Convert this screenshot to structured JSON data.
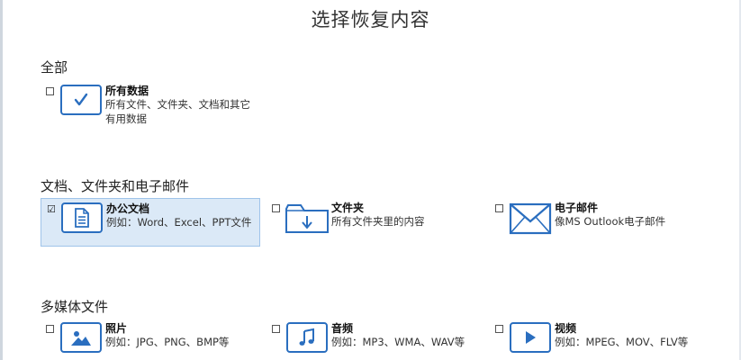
{
  "window": {
    "title": "选择恢复内容"
  },
  "sections": [
    {
      "title": "全部",
      "items": [
        {
          "label": "所有数据",
          "desc": "所有文件、文件夹、文档和其它有用数据",
          "icon": "checkmark-icon",
          "checked": false
        }
      ]
    },
    {
      "title": "文档、文件夹和电子邮件",
      "items": [
        {
          "label": "办公文档",
          "desc": "例如：Word、Excel、PPT文件",
          "icon": "document-icon",
          "checked": true
        },
        {
          "label": "文件夹",
          "desc": "所有文件夹里的内容",
          "icon": "folder-icon",
          "checked": false
        },
        {
          "label": "电子邮件",
          "desc": "像MS Outlook电子邮件",
          "icon": "mail-icon",
          "checked": false
        }
      ]
    },
    {
      "title": "多媒体文件",
      "items": [
        {
          "label": "照片",
          "desc": "例如：JPG、PNG、BMP等",
          "icon": "photo-icon",
          "checked": false
        },
        {
          "label": "音频",
          "desc": "例如：MP3、WMA、WAV等",
          "icon": "music-note-icon",
          "checked": false
        },
        {
          "label": "视频",
          "desc": "例如：MPEG、MOV、FLV等",
          "icon": "play-icon",
          "checked": false
        }
      ]
    }
  ],
  "checkbox_mark": "☑",
  "colors": {
    "accent": "#2a6ebf",
    "selected_bg": "#dbe9f7",
    "selected_border": "#9fc4ea"
  }
}
